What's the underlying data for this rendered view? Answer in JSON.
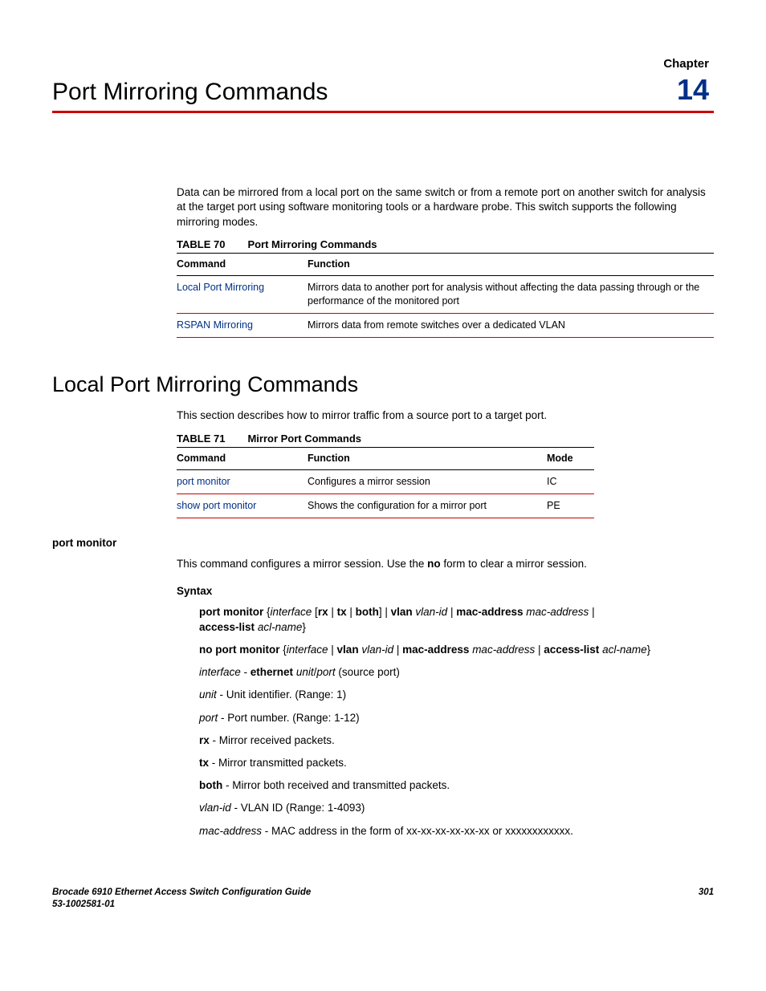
{
  "chapter": {
    "label": "Chapter",
    "number": "14",
    "title": "Port Mirroring Commands"
  },
  "intro": "Data can be mirrored from a local port on the same switch or from a remote port on another switch for analysis at the target port using software monitoring tools or a hardware probe. This switch supports the following mirroring modes.",
  "table70": {
    "label": "TABLE 70",
    "title": "Port Mirroring Commands",
    "headers": {
      "c1": "Command",
      "c2": "Function"
    },
    "rows": [
      {
        "cmd": "Local Port Mirroring",
        "func": "Mirrors data to another port for analysis without affecting the data passing through or the performance of the monitored port"
      },
      {
        "cmd": "RSPAN Mirroring",
        "func": "Mirrors data from remote switches over a dedicated VLAN"
      }
    ]
  },
  "section": {
    "title": "Local Port Mirroring Commands",
    "intro": "This section describes how to mirror traffic from a source port to a target port."
  },
  "table71": {
    "label": "TABLE 71",
    "title": "Mirror Port Commands",
    "headers": {
      "c1": "Command",
      "c2": "Function",
      "c3": "Mode"
    },
    "rows": [
      {
        "cmd": "port monitor",
        "func": "Configures a mirror session",
        "mode": "IC"
      },
      {
        "cmd": "show port monitor",
        "func": "Shows the configuration for a mirror port",
        "mode": "PE"
      }
    ]
  },
  "command": {
    "name": "port monitor",
    "desc_pre": "This command configures a mirror session. Use the ",
    "desc_bold": "no",
    "desc_post": " form to clear a mirror session.",
    "syntax_label": "Syntax",
    "line1": {
      "p1": "port monitor",
      "p2": " {",
      "p3": "interface",
      "p4": " [",
      "p5": "rx",
      "p6": " | ",
      "p7": "tx",
      "p8": " | ",
      "p9": "both",
      "p10": "] | ",
      "p11": "vlan",
      "p12": " ",
      "p13": "vlan-id",
      "p14": " | ",
      "p15": "mac-address",
      "p16": " ",
      "p17": "mac-address",
      "p18": " | ",
      "p19": "access-list",
      "p20": " ",
      "p21": "acl-name",
      "p22": "}"
    },
    "line2": {
      "p1": "no port monitor",
      "p2": " {",
      "p3": "interface",
      "p4": " | ",
      "p5": "vlan",
      "p6": " ",
      "p7": "vlan-id",
      "p8": " | ",
      "p9": "mac-address",
      "p10": " ",
      "p11": "mac-address",
      "p12": " | ",
      "p13": "access-list",
      "p14": " ",
      "p15": "acl-name",
      "p16": "}"
    },
    "def_interface": {
      "p1": "interface",
      "p2": " - ",
      "p3": "ethernet",
      "p4": " ",
      "p5": "unit",
      "p6": "/",
      "p7": "port",
      "p8": " (source port)"
    },
    "def_unit": {
      "p1": "unit",
      "p2": " - Unit identifier. (Range: 1)"
    },
    "def_port": {
      "p1": "port",
      "p2": " - Port number. (Range: 1-12)"
    },
    "def_rx": {
      "p1": "rx",
      "p2": " - Mirror received packets."
    },
    "def_tx": {
      "p1": "tx",
      "p2": " - Mirror transmitted packets."
    },
    "def_both": {
      "p1": "both",
      "p2": " - Mirror both received and transmitted packets."
    },
    "def_vlan": {
      "p1": "vlan-id",
      "p2": " - VLAN ID (Range: 1-4093)"
    },
    "def_mac": {
      "p1": "mac-address",
      "p2": " - MAC address in the form of xx-xx-xx-xx-xx-xx or xxxxxxxxxxxx."
    }
  },
  "footer": {
    "left1": "Brocade 6910 Ethernet Access Switch Configuration Guide",
    "left2": "53-1002581-01",
    "right": "301"
  }
}
